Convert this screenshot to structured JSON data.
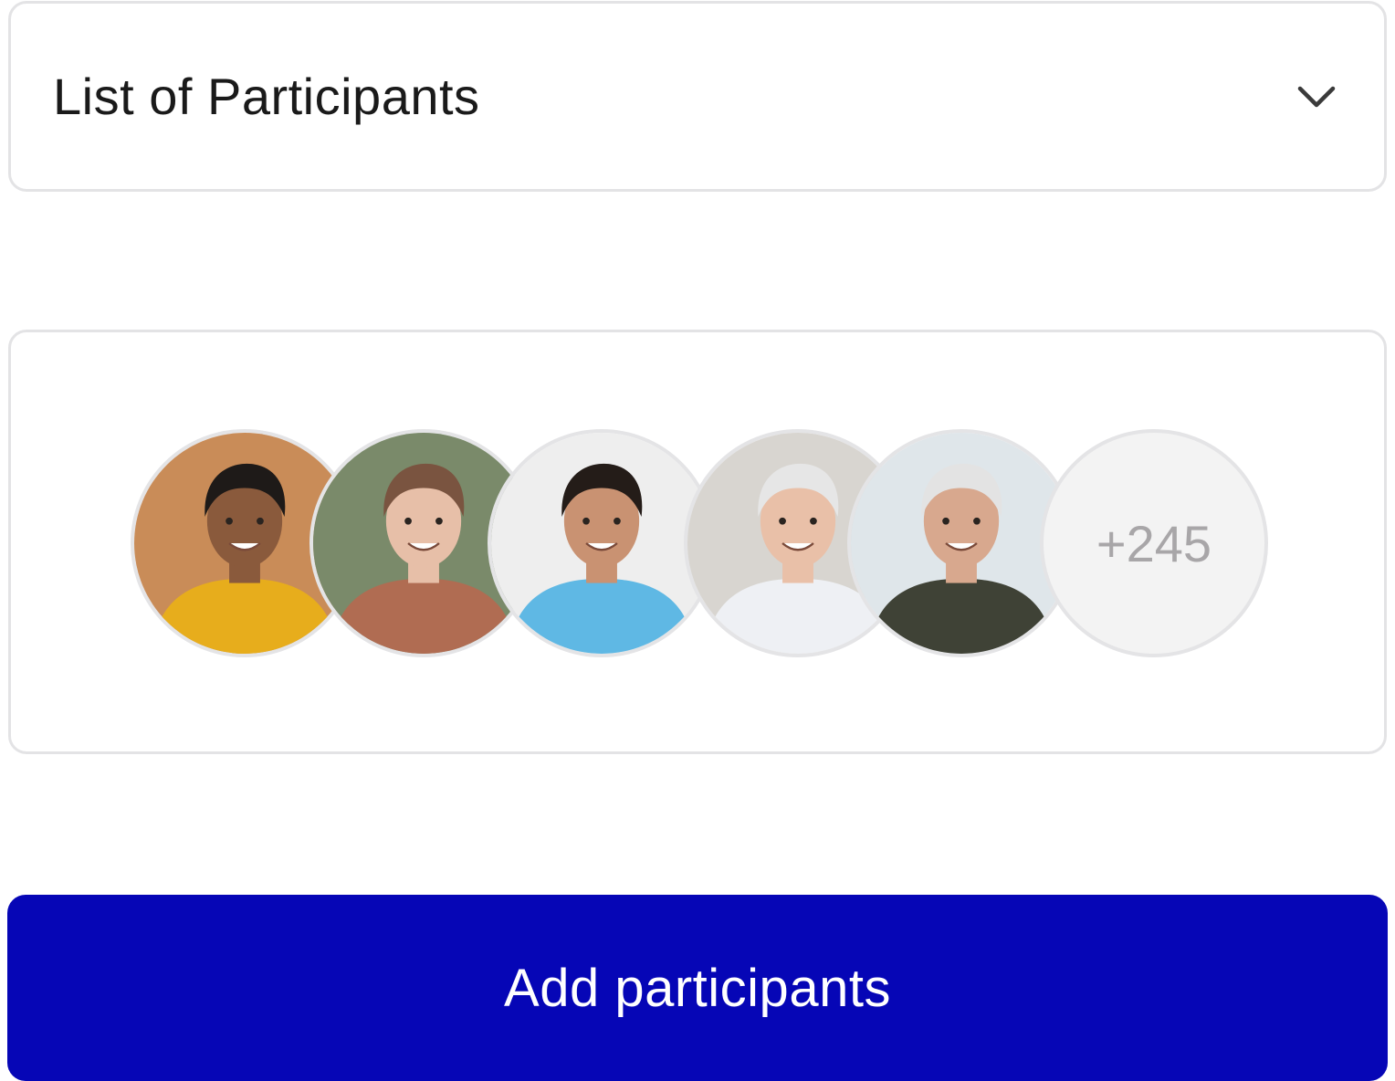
{
  "dropdown": {
    "title": "List of Participants",
    "toggle_icon": "chevron-down-icon"
  },
  "participants": {
    "avatars": [
      {
        "icon": "avatar-photo",
        "background": "#c98c58",
        "shirt": "#e7ad1c",
        "skin": "#8a5a3c",
        "hair": "#1e1a18"
      },
      {
        "icon": "avatar-photo",
        "background": "#7a8a6a",
        "shirt": "#b06c52",
        "skin": "#e7bfa8",
        "hair": "#7a5440"
      },
      {
        "icon": "avatar-photo",
        "background": "#eeeeee",
        "shirt": "#5fb8e4",
        "skin": "#c99272",
        "hair": "#241c18"
      },
      {
        "icon": "avatar-photo",
        "background": "#d8d5d0",
        "shirt": "#eef0f4",
        "skin": "#e9c0a8",
        "hair": "#e6e6e6"
      },
      {
        "icon": "avatar-photo",
        "background": "#dfe6ea",
        "shirt": "#3f4236",
        "skin": "#d8a88e",
        "hair": "#e3e3e3"
      }
    ],
    "more_count": "+245"
  },
  "actions": {
    "add_label": "Add participants",
    "add_color": "#0606b6"
  }
}
